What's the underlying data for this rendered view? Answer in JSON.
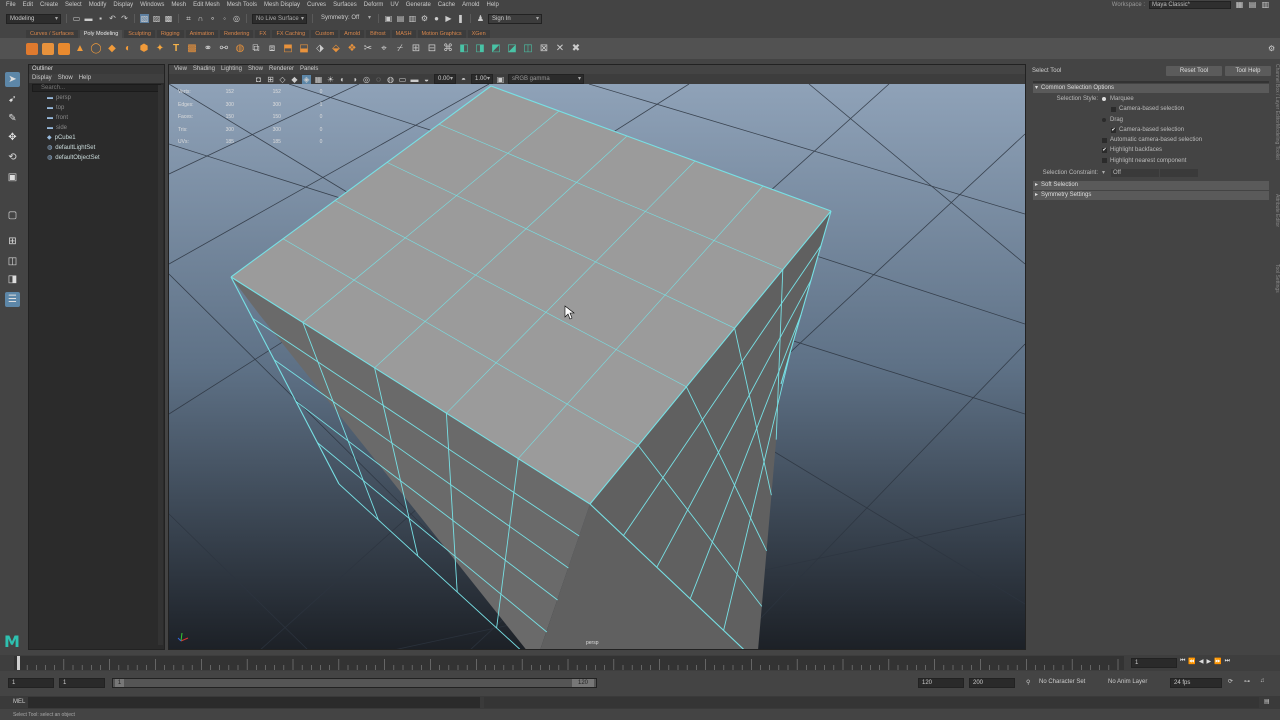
{
  "menubar": {
    "items": [
      "File",
      "Edit",
      "Create",
      "Select",
      "Modify",
      "Display",
      "Windows",
      "Mesh",
      "Edit Mesh",
      "Mesh Tools",
      "Mesh Display",
      "Curves",
      "Surfaces",
      "Deform",
      "UV",
      "Generate",
      "Cache",
      "Arnold",
      "Help"
    ],
    "workspace_label": "Workspace :",
    "workspace_value": "Maya Classic*"
  },
  "statusline": {
    "mode": "Modeling",
    "live_surface": "No Live Surface",
    "symmetry": "Symmetry: Off",
    "sign_in": "Sign In"
  },
  "shelf": {
    "tabs": [
      "Curves / Surfaces",
      "Poly Modeling",
      "Sculpting",
      "Rigging",
      "Animation",
      "Rendering",
      "FX",
      "FX Caching",
      "Custom",
      "Arnold",
      "Bifrost",
      "MASH",
      "Motion Graphics",
      "XGen"
    ],
    "active_tab": "Poly Modeling"
  },
  "outliner": {
    "title": "Outliner",
    "menus": [
      "Display",
      "Show",
      "Help"
    ],
    "search_placeholder": "Search...",
    "items": [
      {
        "label": "persp",
        "kind": "camera"
      },
      {
        "label": "top",
        "kind": "camera"
      },
      {
        "label": "front",
        "kind": "camera"
      },
      {
        "label": "side",
        "kind": "camera"
      },
      {
        "label": "pCube1",
        "kind": "mesh"
      },
      {
        "label": "defaultLightSet",
        "kind": "set"
      },
      {
        "label": "defaultObjectSet",
        "kind": "set"
      }
    ]
  },
  "viewport": {
    "menus": [
      "View",
      "Shading",
      "Lighting",
      "Show",
      "Renderer",
      "Panels"
    ],
    "exposure": "0.00",
    "gamma": "1.00",
    "color_space": "sRGB gamma",
    "camera_label": "persp",
    "hud": [
      {
        "label": "Verts:",
        "v1": "152",
        "v2": "152",
        "v3": "0"
      },
      {
        "label": "Edges:",
        "v1": "300",
        "v2": "300",
        "v3": "1"
      },
      {
        "label": "Faces:",
        "v1": "150",
        "v2": "150",
        "v3": "0"
      },
      {
        "label": "Tris:",
        "v1": "300",
        "v2": "300",
        "v3": "0"
      },
      {
        "label": "UVs:",
        "v1": "185",
        "v2": "185",
        "v3": "0"
      }
    ]
  },
  "tool_settings": {
    "title": "Select Tool",
    "reset_button": "Reset Tool",
    "help_button": "Tool Help",
    "common_frame": "Common Selection Options",
    "selection_style_label": "Selection Style:",
    "marquee": "Marquee",
    "camera_based_1": "Camera-based selection",
    "drag": "Drag",
    "camera_based_2": "Camera-based selection",
    "auto_camera": "Automatic camera-based selection",
    "highlight_backfaces": "Highlight backfaces",
    "highlight_nearest": "Highlight nearest component",
    "constraint_label": "Selection Constraint:",
    "constraint_value": "Off",
    "soft_selection": "Soft Selection",
    "symmetry_settings": "Symmetry Settings"
  },
  "side_tabs": [
    "Channel Box / Layer Editor",
    "Modeling Toolkit",
    "Attribute Editor",
    "Tool Settings"
  ],
  "timeline": {
    "current_frame": "1",
    "range_start": "1",
    "range_start_inner": "1",
    "range_end_inner": "120",
    "slider_value": "1",
    "slider_end": "120",
    "range_end": "120",
    "range_end_outer": "200",
    "char_set": "No Character Set",
    "anim_layer": "No Anim Layer",
    "fps": "24 fps"
  },
  "command_line": {
    "label": "MEL"
  },
  "help_line": "Select Tool: select an object",
  "colors": {
    "accent": "#5fc8d6",
    "wire": "#77e0e4",
    "shelf_tab": "#d9874c"
  }
}
